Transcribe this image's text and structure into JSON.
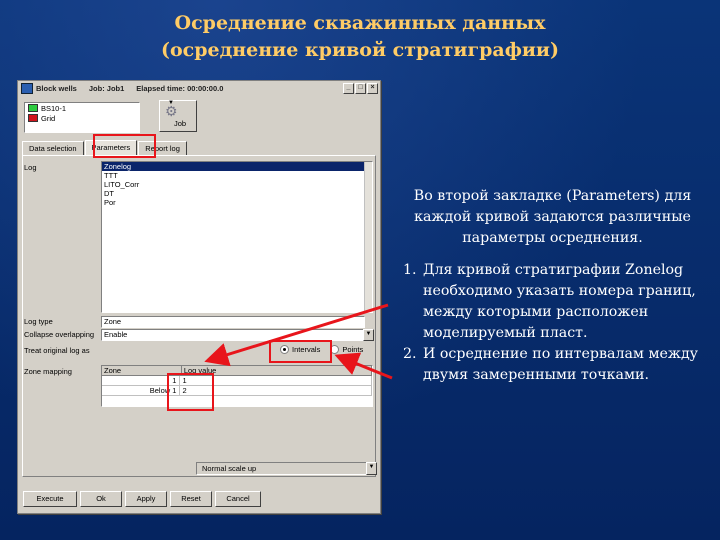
{
  "slide": {
    "title_line1": "Осреднение скважинных данных",
    "title_line2": "(осреднение кривой стратиграфии)"
  },
  "window": {
    "title": "Block wells",
    "job_label": "Job: Job1",
    "elapsed_label": "Elapsed time: 00:00:00.0",
    "controls": [
      "_",
      "□",
      "×"
    ]
  },
  "wells": [
    {
      "name": "BS10-1",
      "color": "#2ecc40"
    },
    {
      "name": "Grid",
      "color": "#d0141c"
    }
  ],
  "job_button": {
    "label": "Job",
    "icon": "gear-icon"
  },
  "tabs": [
    {
      "label": "Data selection",
      "active": false
    },
    {
      "label": "Parameters",
      "active": true
    },
    {
      "label": "Report log",
      "active": false
    }
  ],
  "params": {
    "log_label": "Log",
    "logs": [
      {
        "name": "Zonelog",
        "selected": true
      },
      {
        "name": "TTT",
        "selected": false
      },
      {
        "name": "LITO_Corr",
        "selected": false
      },
      {
        "name": "DT",
        "selected": false
      },
      {
        "name": "Por",
        "selected": false
      }
    ],
    "log_type_label": "Log type",
    "log_type_value": "Zone",
    "collapse_label": "Collapse overlapping",
    "collapse_value": "Enable",
    "treat_label": "Treat original log as",
    "radio_intervals": "Intervals",
    "radio_points": "Points",
    "zone_mapping_label": "Zone mapping",
    "zone_headers": [
      "Zone",
      "Log value"
    ],
    "zone_rows": [
      {
        "zone": "1",
        "log_value": "1"
      },
      {
        "zone": "Below 1",
        "log_value": "2"
      }
    ],
    "mode_value": "Normal scale up"
  },
  "buttons": [
    "Execute",
    "Ok",
    "Apply",
    "Reset",
    "Cancel"
  ],
  "explanation": {
    "intro": "Во второй закладке (Parameters) для каждой кривой задаются различные параметры осреднения.",
    "items": [
      "Для кривой стратиграфии Zonelog необходимо указать номера границ, между которыми расположен моделируемый пласт.",
      "И осреднение по интервалам между двумя замеренными точками."
    ]
  },
  "colors": {
    "highlight": "#e8151b",
    "title": "#ffcc66",
    "background": "#062a6a"
  }
}
